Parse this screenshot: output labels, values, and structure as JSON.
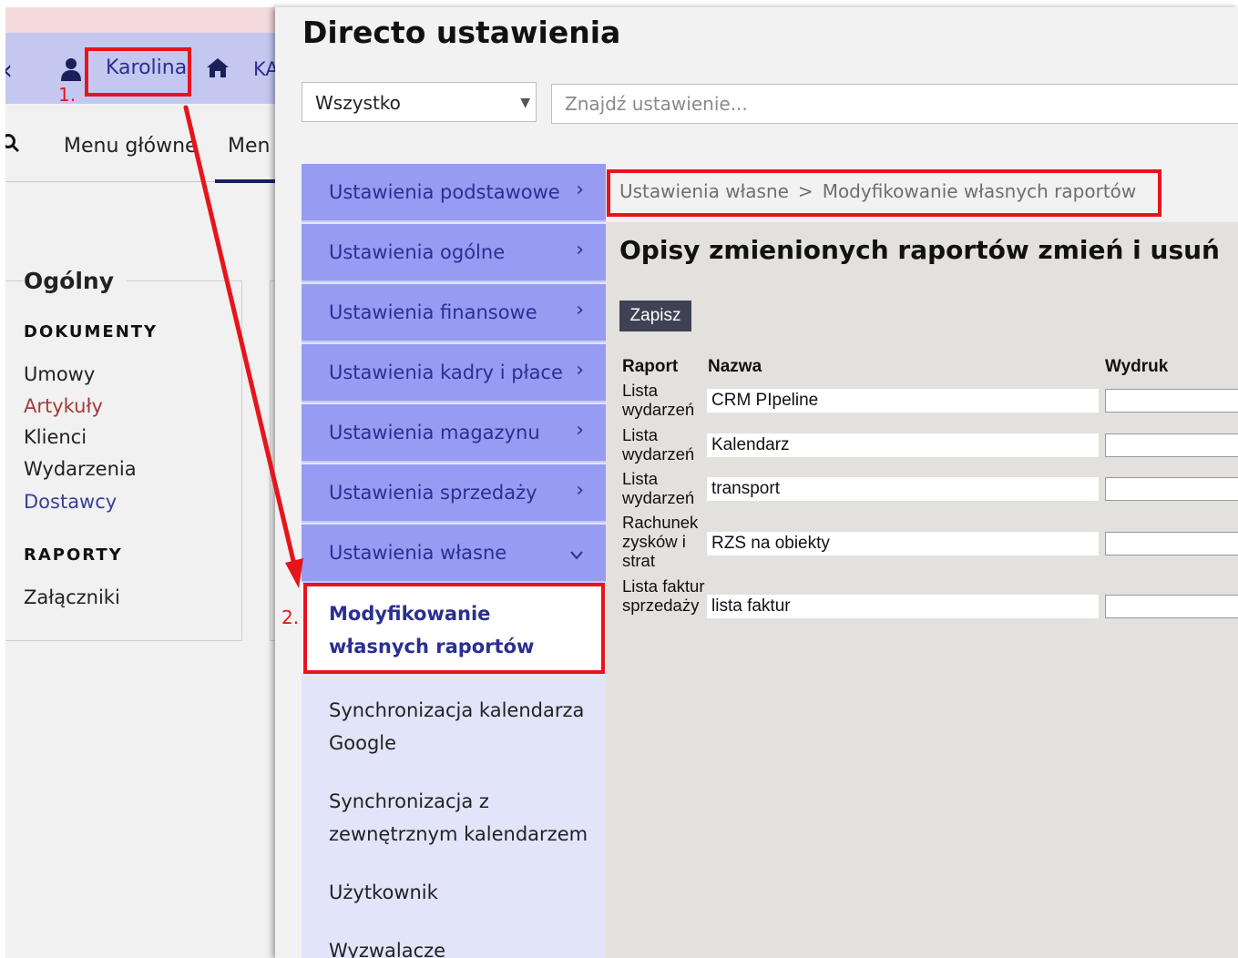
{
  "background_app": {
    "user_name": "Karolina",
    "company_short": "KA",
    "nav": {
      "main_menu": "Menu główne",
      "second_menu": "Men"
    },
    "panel": {
      "title": "Ogólny",
      "documents_heading": "DOKUMENTY",
      "documents": [
        "Umowy",
        "Artykuły",
        "Klienci",
        "Wydarzenia",
        "Dostawcy"
      ],
      "reports_heading": "RAPORTY",
      "reports": [
        "Załączniki"
      ]
    }
  },
  "overlay": {
    "title": "Directo ustawienia",
    "filter": {
      "selected": "Wszystko"
    },
    "search": {
      "placeholder": "Znajdź ustawienie..."
    },
    "menu": [
      {
        "label": "Ustawienia podstawowe",
        "expanded": false
      },
      {
        "label": "Ustawienia ogólne",
        "expanded": false
      },
      {
        "label": "Ustawienia finansowe",
        "expanded": false
      },
      {
        "label": "Ustawienia kadry i płace",
        "expanded": false
      },
      {
        "label": "Ustawienia magazynu",
        "expanded": false
      },
      {
        "label": "Ustawienia sprzedaży",
        "expanded": false
      },
      {
        "label": "Ustawienia własne",
        "expanded": true
      }
    ],
    "submenu": [
      {
        "label": "Modyfikowanie własnych raportów",
        "active": true
      },
      {
        "label": "Synchronizacja kalendarza Google",
        "active": false
      },
      {
        "label": "Synchronizacja z zewnętrznym kalendarzem",
        "active": false
      },
      {
        "label": "Użytkownik",
        "active": false
      },
      {
        "label": "Wyzwalacze",
        "active": false
      }
    ],
    "breadcrumb": [
      "Ustawienia własne",
      "Modyfikowanie własnych raportów"
    ],
    "breadcrumb_separator": ">",
    "content": {
      "title": "Opisy zmienionych raportów zmień i usuń",
      "save_label": "Zapisz",
      "columns": {
        "report": "Raport",
        "name": "Nazwa",
        "print": "Wydruk"
      },
      "rows": [
        {
          "report": "Lista wydarzeń",
          "name": "CRM PIpeline",
          "print": ""
        },
        {
          "report": "Lista wydarzeń",
          "name": "Kalendarz",
          "print": ""
        },
        {
          "report": "Lista wydarzeń",
          "name": "transport",
          "print": ""
        },
        {
          "report": "Rachunek zysków i strat",
          "name": "RZS na obiekty",
          "print": ""
        },
        {
          "report": "Lista faktur sprzedaży",
          "name": "lista faktur",
          "print": ""
        }
      ]
    }
  },
  "annotations": {
    "step1": "1.",
    "step2": "2."
  },
  "colors": {
    "menu_item_bg": "#979cf2",
    "menu_text": "#2a2f92",
    "annotation_red": "#e8141b",
    "save_button_bg": "#3f4154"
  }
}
